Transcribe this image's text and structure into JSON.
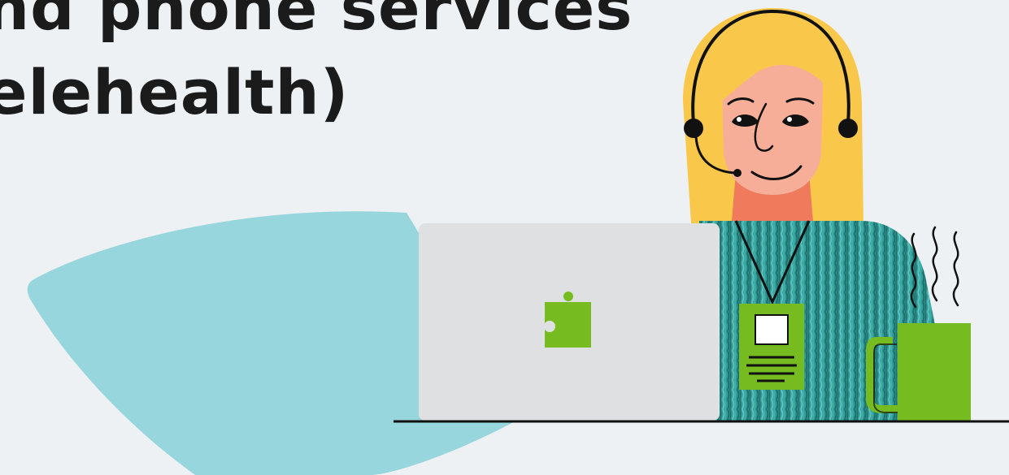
{
  "headline": {
    "line1": "nd phone services",
    "line2": "elehealth)"
  },
  "colors": {
    "background": "#eef1f4",
    "blob": "#96d6dc",
    "laptop": "#dfe0e1",
    "puzzle_accent": "#76bc21",
    "sweater": "#2f9a96",
    "hair": "#f9c84a",
    "skin": "#f6ae99",
    "neck": "#ef7b5c",
    "mug": "#76bc21",
    "ink": "#111111"
  },
  "icons": {
    "laptop_logo": "puzzle-piece-icon"
  }
}
